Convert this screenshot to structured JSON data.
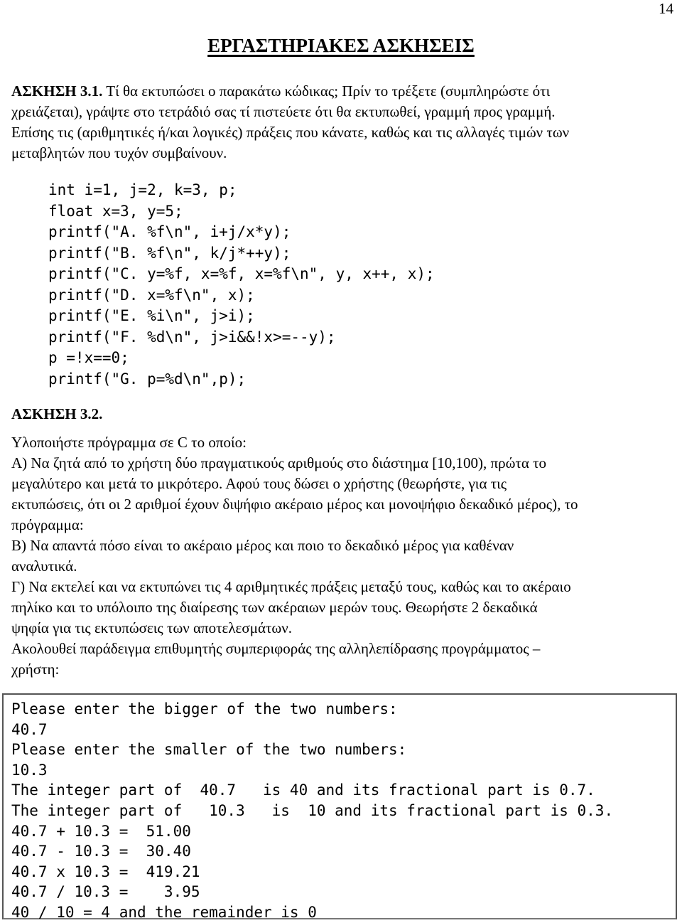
{
  "page": {
    "number": "14",
    "title": "ΕΡΓΑΣΤΗΡΙΑΚΕΣ ΑΣΚΗΣΕΙΣ"
  },
  "exercise_1": {
    "heading": "ΑΣΚΗΣΗ 3.1.",
    "instructions_lines": [
      "Τί θα εκτυπώσει ο παρακάτω κώδικας; Πρίν το τρέξετε (συμπληρώστε ότι",
      "χρειάζεται), γράψτε στο τετράδιό σας τί πιστεύετε ότι θα εκτυπωθεί, γραμμή προς γραμμή.",
      "Επίσης τις (αριθμητικές ή/και λογικές) πράξεις που κάνατε, καθώς και τις αλλαγές τιμών των",
      "μεταβλητών που τυχόν συμβαίνουν."
    ],
    "code_lines": [
      "int i=1, j=2, k=3, p;",
      "float x=3, y=5;",
      "printf(\"A. %f\\n\", i+j/x*y);",
      "printf(\"B. %f\\n\", k/j*++y);",
      "printf(\"C. y=%f, x=%f, x=%f\\n\", y, x++, x);",
      "printf(\"D. x=%f\\n\", x);",
      "printf(\"E. %i\\n\", j>i);",
      "printf(\"F. %d\\n\", j>i&&!x>=--y);",
      "p =!x==0;",
      "printf(\"G. p=%d\\n\",p);"
    ]
  },
  "exercise_2": {
    "heading": "ΑΣΚΗΣΗ 3.2.",
    "body_lines": [
      "Υλοποιήστε πρόγραμμα σε C το οποίο:",
      "Α) Να ζητά από το χρήστη δύο πραγματικούς αριθμούς στο διάστημα [10,100), πρώτα το",
      "μεγαλύτερο και μετά το μικρότερο. Αφού τους δώσει ο χρήστης (θεωρήστε, για τις",
      "εκτυπώσεις, ότι οι 2 αριθμοί έχουν διψήφιο ακέραιο μέρος και μονοψήφιο δεκαδικό μέρος), το",
      "πρόγραμμα:",
      "Β) Να απαντά πόσο είναι το ακέραιο μέρος και ποιο το δεκαδικό μέρος για καθέναν",
      "αναλυτικά.",
      "Γ) Να εκτελεί και να εκτυπώνει τις 4 αριθμητικές πράξεις μεταξύ τους, καθώς και το ακέραιο",
      "πηλίκο και το υπόλοιπο της διαίρεσης των ακέραιων μερών τους. Θεωρήστε 2 δεκαδικά",
      "ψηφία για τις εκτυπώσεις των αποτελεσμάτων.",
      "Ακολουθεί παράδειγμα επιθυμητής συμπεριφοράς της αλληλεπίδρασης προγράμματος –",
      "χρήστη:"
    ],
    "sample_output_lines": [
      "Please enter the bigger of the two numbers:",
      "40.7",
      "Please enter the smaller of the two numbers:",
      "10.3",
      "The integer part of  40.7   is 40 and its fractional part is 0.7.",
      "The integer part of   10.3   is  10 and its fractional part is 0.3.",
      "40.7 + 10.3 =  51.00",
      "40.7 - 10.3 =  30.40",
      "40.7 x 10.3 =  419.21",
      "40.7 / 10.3 =    3.95",
      "40 / 10 = 4 and the remainder is 0"
    ]
  }
}
